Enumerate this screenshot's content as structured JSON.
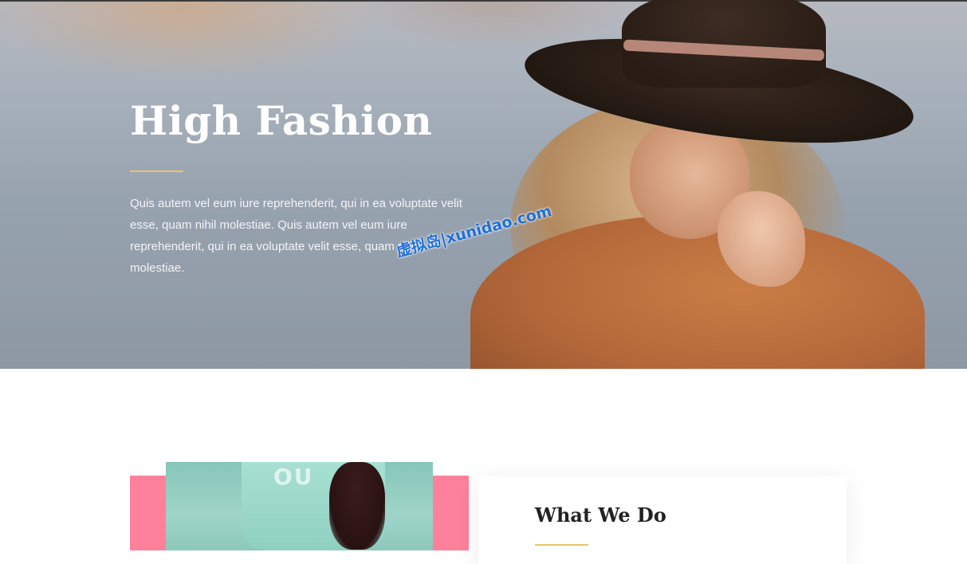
{
  "hero": {
    "title": "High Fashion",
    "body": "Quis autem vel eum iure reprehenderit, qui in ea voluptate velit esse, quam nihil molestiae. Quis autem vel eum iure reprehenderit, qui in ea voluptate velit esse, quam nihil molestiae."
  },
  "watermark": "虚拟岛|xunidao.com",
  "features": {
    "title": "What We Do",
    "print_text": "OU"
  },
  "colors": {
    "accent": "#e9c46a",
    "pink": "#fd819a",
    "watermark": "#1e6fd6"
  }
}
